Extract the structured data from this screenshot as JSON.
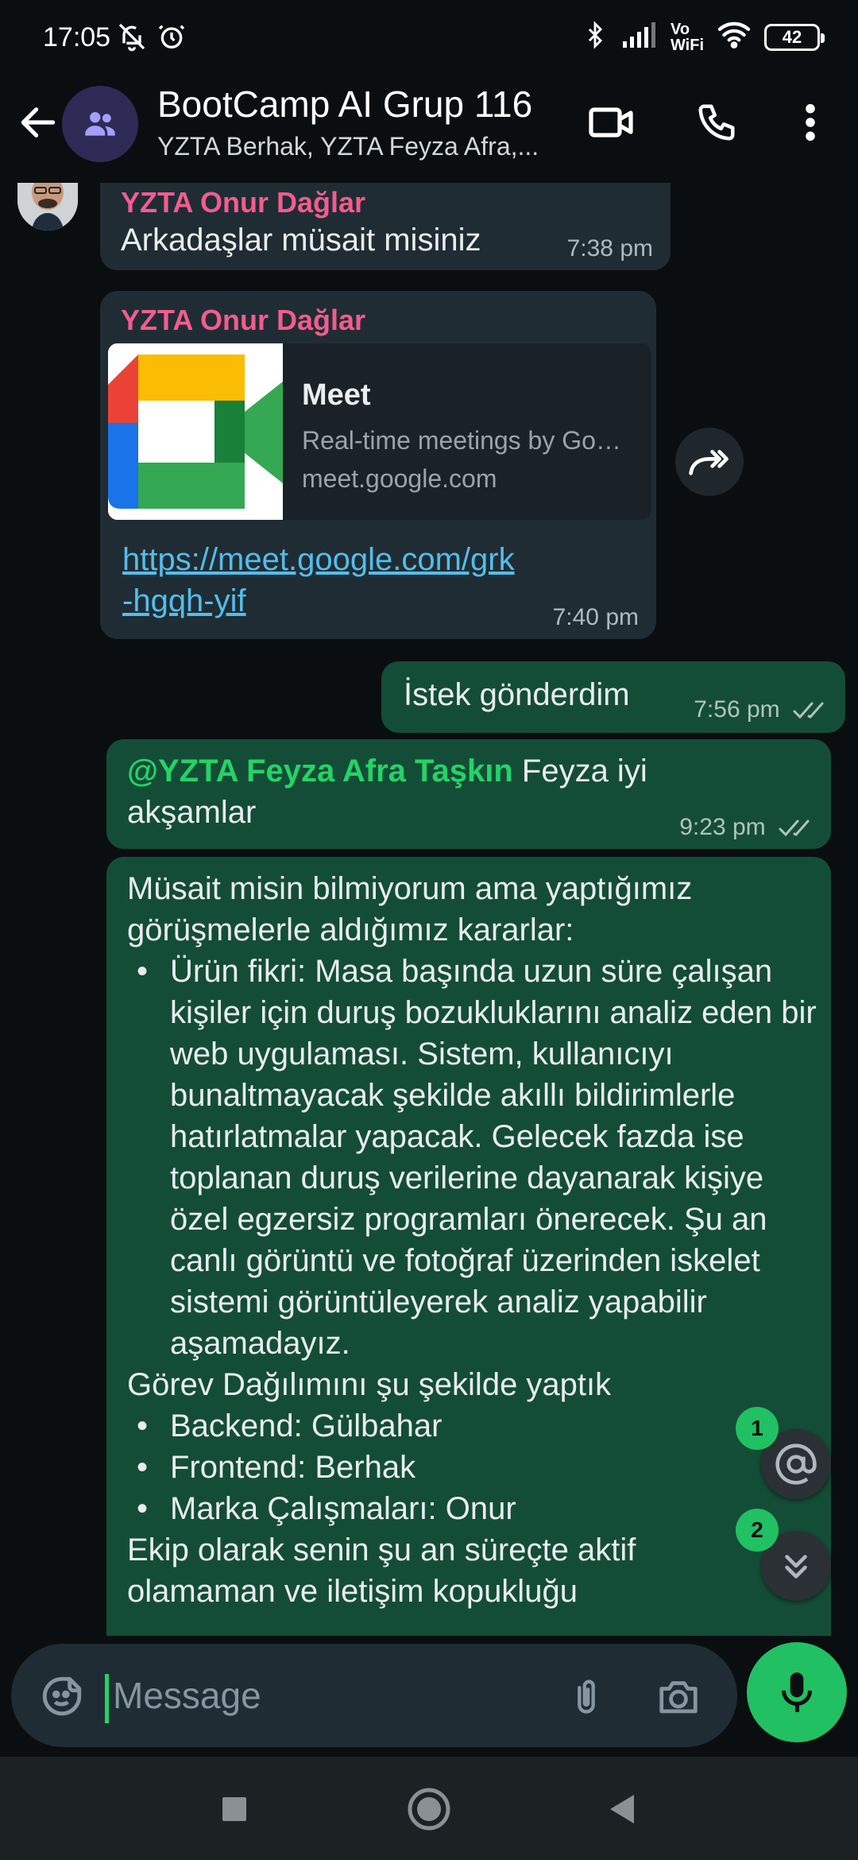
{
  "status_bar": {
    "time": "17:05",
    "volte_line1": "Vo",
    "volte_line2": "WiFi",
    "battery": "42"
  },
  "header": {
    "title": "BootCamp AI Grup 116",
    "subtitle": "YZTA Berhak, YZTA Feyza Afra,..."
  },
  "messages": {
    "m1": {
      "sender": "YZTA Onur Dağlar",
      "text": "Arkadaşlar müsait misiniz",
      "time": "7:38 pm"
    },
    "m2": {
      "sender": "YZTA Onur Dağlar",
      "link_title": "Meet",
      "link_desc": "Real-time meetings by Google...",
      "link_domain": "meet.google.com",
      "url_line1": "https://meet.google.com/grk",
      "url_line2": "-hgqh-yif",
      "time": "7:40 pm"
    },
    "m3": {
      "text": "İstek gönderdim",
      "time": "7:56 pm"
    },
    "m4": {
      "mention": "@YZTA Feyza Afra Taşkın",
      "text_after": " Feyza iyi",
      "text_line2": "akşamlar",
      "time": "9:23 pm"
    },
    "m5": {
      "intro_line1": "Müsait misin bilmiyorum ama yaptığımız",
      "intro_line2": "görüşmelerle aldığımız kararlar:",
      "point1": "Ürün fikri: Masa başında uzun süre çalışan kişiler için duruş bozukluklarını analiz eden bir web uygulaması. Sistem, kullanıcıyı bunaltmayacak şekilde akıllı bildirimlerle hatırlatmalar yapacak. Gelecek fazda ise toplanan duruş verilerine dayanarak kişiye özel egzersiz programları önerecek. Şu an canlı görüntü ve fotoğraf üzerinden iskelet sistemi görüntüleyerek analiz yapabilir aşamadayız.",
      "tasks_heading": "Görev Dağılımını şu şekilde yaptık",
      "task1": "Backend: Gülbahar",
      "task2": "Frontend: Berhak",
      "task3": "Marka Çalışmaları: Onur",
      "outro_line1": "Ekip olarak senin şu an süreçte aktif",
      "outro_line2": "olamaman ve iletişim kopukluğu"
    }
  },
  "fabs": {
    "mentions_badge": "1",
    "scroll_badge": "2"
  },
  "input": {
    "placeholder": "Message"
  },
  "colors": {
    "accent_green": "#21c063",
    "sender_pink": "#f15c8e",
    "link_blue": "#53bdeb",
    "outgoing_bubble": "#144d37",
    "incoming_bubble": "#202c33"
  },
  "icons": [
    "bell-off-icon",
    "alarm-icon",
    "bluetooth-icon",
    "signal-icon",
    "wifi-icon",
    "back-arrow-icon",
    "group-icon",
    "video-call-icon",
    "phone-icon",
    "more-vert-icon",
    "forward-icon",
    "double-check-icon",
    "at-icon",
    "chevrons-down-icon",
    "sticker-icon",
    "paperclip-icon",
    "camera-icon",
    "mic-icon",
    "nav-recents-icon",
    "nav-home-icon",
    "nav-back-icon"
  ]
}
